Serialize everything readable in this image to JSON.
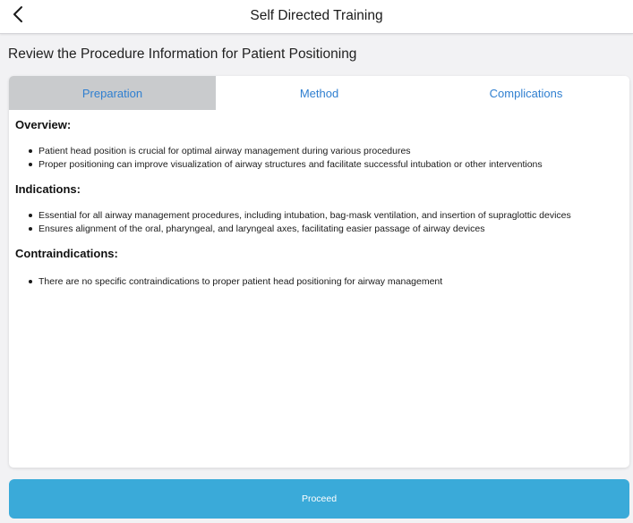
{
  "header": {
    "title": "Self Directed Training",
    "back_icon": "chevron-left-icon"
  },
  "page": {
    "heading": "Review the Procedure Information for Patient Positioning"
  },
  "tabs": [
    {
      "label": "Preparation",
      "active": true
    },
    {
      "label": "Method",
      "active": false
    },
    {
      "label": "Complications",
      "active": false
    }
  ],
  "sections": [
    {
      "title": "Overview:",
      "bullets": [
        "Patient head position is crucial for optimal airway management during various procedures",
        "Proper positioning can improve visualization of airway structures and facilitate successful intubation or other interventions"
      ]
    },
    {
      "title": "Indications:",
      "bullets": [
        "Essential for all airway management procedures, including intubation, bag-mask ventilation, and insertion of supraglottic devices",
        "Ensures alignment of the oral, pharyngeal, and laryngeal axes, facilitating easier passage of airway devices"
      ]
    },
    {
      "title": "Contraindications:",
      "bullets": [
        "There are no specific contraindications to proper patient head positioning for airway management"
      ]
    }
  ],
  "footer": {
    "proceed_label": "Proceed"
  },
  "colors": {
    "accent": "#2f7fd0",
    "button": "#3aaad9",
    "active_tab": "#c9cbcd"
  }
}
